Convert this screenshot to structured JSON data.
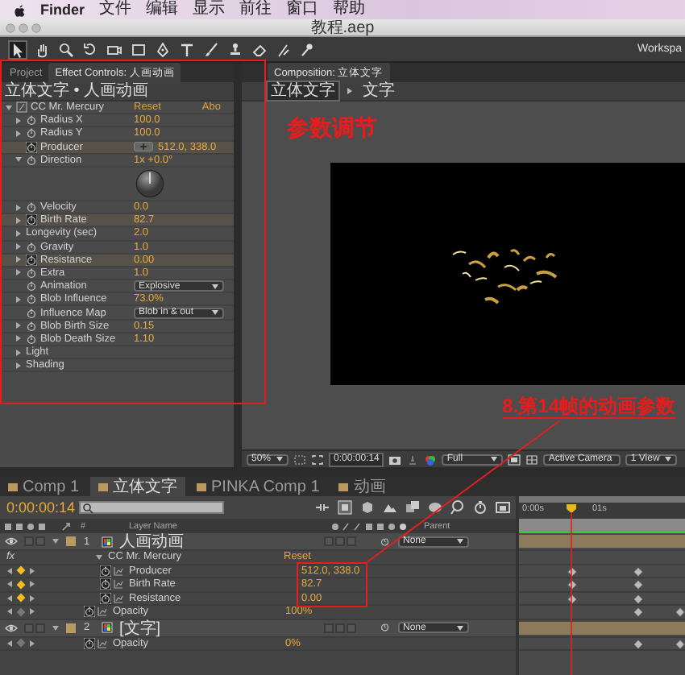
{
  "menu_bar": {
    "app": "Finder",
    "items": [
      "文件",
      "编辑",
      "显示",
      "前往",
      "窗口",
      "帮助"
    ]
  },
  "window": {
    "title": "教程.aep"
  },
  "toolbar": {
    "workspace_label": "Workspa"
  },
  "effect_controls": {
    "framed": true,
    "tabs": [
      {
        "label": "Project",
        "selected": false
      },
      {
        "label": "Effect Controls: 人画动画",
        "selected": true
      }
    ],
    "breadcrumb": "立体文字 • 人画动画",
    "effect": {
      "name": "CC Mr. Mercury",
      "reset": "Reset",
      "about": "Abo",
      "expanded": true
    },
    "properties": [
      {
        "kind": "number",
        "name": "Radius X",
        "value": "100.0",
        "expanded": false,
        "keyframed": false
      },
      {
        "kind": "number",
        "name": "Radius Y",
        "value": "100.0",
        "expanded": false,
        "keyframed": false
      },
      {
        "kind": "point",
        "name": "Producer",
        "value": "512.0, 338.0",
        "keyframed": true
      },
      {
        "kind": "angle",
        "name": "Direction",
        "value": "1x +0.0°",
        "expanded": true,
        "keyframed": false
      },
      {
        "kind": "number",
        "name": "Velocity",
        "value": "0.0",
        "expanded": false,
        "keyframed": false
      },
      {
        "kind": "number",
        "name": "Birth Rate",
        "value": "82.7",
        "expanded": false,
        "keyframed": true
      },
      {
        "kind": "number",
        "name": "Longevity (sec)",
        "value": "2.0",
        "expanded": false
      },
      {
        "kind": "number",
        "name": "Gravity",
        "value": "1.0",
        "expanded": false,
        "keyframed": false
      },
      {
        "kind": "number",
        "name": "Resistance",
        "value": "0.00",
        "expanded": false,
        "keyframed": true
      },
      {
        "kind": "number",
        "name": "Extra",
        "value": "1.0",
        "expanded": false,
        "keyframed": false
      },
      {
        "kind": "dropdown",
        "name": "Animation",
        "value": "Explosive",
        "keyframed": false
      },
      {
        "kind": "number",
        "name": "Blob Influence",
        "value": "73.0%",
        "expanded": false,
        "keyframed": false
      },
      {
        "kind": "dropdown",
        "name": "Influence Map",
        "value": "Blob in & out",
        "keyframed": false
      },
      {
        "kind": "number",
        "name": "Blob Birth Size",
        "value": "0.15",
        "expanded": false,
        "keyframed": false
      },
      {
        "kind": "number",
        "name": "Blob Death Size",
        "value": "1.10",
        "expanded": false,
        "keyframed": false
      },
      {
        "kind": "group",
        "name": "Light",
        "expanded": false
      },
      {
        "kind": "group",
        "name": "Shading",
        "expanded": false
      }
    ]
  },
  "composition": {
    "tabs": [
      {
        "label": "Composition: 立体文字",
        "selected": true
      }
    ],
    "breadcrumb": [
      {
        "label": "立体文字",
        "selected": true
      },
      {
        "label": "文字",
        "selected": false
      }
    ],
    "annotations": [
      {
        "kind": "label",
        "text": "参数调节"
      },
      {
        "kind": "callout",
        "text": "8.第14帧的动画参数"
      }
    ],
    "footer": {
      "zoom": "50%",
      "timecode": "0:00:00:14",
      "resolution": "Full",
      "camera": "Active Camera",
      "views": "1 View"
    }
  },
  "timeline": {
    "tabs": [
      {
        "label": "Comp 1",
        "selected": false
      },
      {
        "label": "立体文字",
        "selected": true
      },
      {
        "label": "PINKA Comp 1",
        "selected": false
      },
      {
        "label": "动画",
        "selected": false
      }
    ],
    "timecode": "0:00:00:14",
    "columns": {
      "number": "#",
      "layer_name": "Layer Name",
      "parent": "Parent"
    },
    "ruler": [
      "0:00s",
      "01s"
    ],
    "playhead": {
      "level": 0.32
    },
    "layers": [
      {
        "kind": "layer",
        "number": "1",
        "name": "人画动画",
        "parent": "None",
        "expanded": true,
        "switches": [
          {
            "on": false
          },
          {
            "on": false
          },
          {
            "on": false
          },
          {
            "on": false
          },
          {
            "on": false
          }
        ],
        "children": [
          {
            "kind": "effect",
            "switch_label": "fx",
            "on": true,
            "name": "CC Mr. Mercury",
            "value": "Reset",
            "expanded": true,
            "children": [
              {
                "kind": "property",
                "name": "Producer",
                "value": "512.0, 338.0",
                "at_keyframe": true,
                "boxed": true,
                "keyframes": [
                  {
                    "level": 0.32
                  },
                  {
                    "level": 0.72
                  }
                ]
              },
              {
                "kind": "property",
                "name": "Birth Rate",
                "value": "82.7",
                "at_keyframe": true,
                "boxed": true,
                "keyframes": [
                  {
                    "level": 0.32
                  },
                  {
                    "level": 0.72
                  }
                ]
              },
              {
                "kind": "property",
                "name": "Resistance",
                "value": "0.00",
                "at_keyframe": true,
                "boxed": true,
                "keyframes": [
                  {
                    "level": 0.32
                  },
                  {
                    "level": 0.72
                  }
                ]
              }
            ]
          },
          {
            "kind": "property",
            "name": "Opacity",
            "value": "100%",
            "at_keyframe": false,
            "boxed": false,
            "keyframes": [
              {
                "level": 0.72
              },
              {
                "level": 0.97
              }
            ]
          }
        ]
      },
      {
        "kind": "layer",
        "number": "2",
        "name": "[文字]",
        "parent": "None",
        "expanded": true,
        "switches": [
          {
            "on": false
          },
          {
            "on": false
          },
          {
            "on": false
          },
          {
            "on": false
          },
          {
            "on": false
          }
        ],
        "children": [
          {
            "kind": "property",
            "name": "Opacity",
            "value": "0%",
            "at_keyframe": false,
            "boxed": false,
            "keyframes": [
              {
                "level": 0.72
              },
              {
                "level": 0.97
              }
            ]
          }
        ]
      }
    ]
  }
}
